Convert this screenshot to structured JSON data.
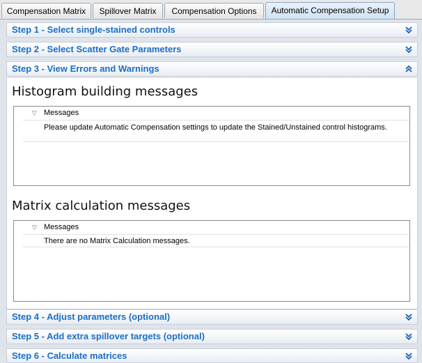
{
  "tabs": [
    {
      "label": "Compensation Matrix"
    },
    {
      "label": "Spillover Matrix"
    },
    {
      "label": "Compensation Options"
    },
    {
      "label": "Automatic Compensation Setup",
      "active": true
    }
  ],
  "steps": {
    "step1": "Step 1 - Select single-stained controls",
    "step2": "Step 2 - Select Scatter Gate Parameters",
    "step3": "Step 3 - View Errors and Warnings",
    "step4": "Step 4 - Adjust parameters (optional)",
    "step5": "Step 5 - Add extra spillover targets (optional)",
    "step6": "Step 6 - Calculate matrices"
  },
  "histogram": {
    "title": "Histogram building messages",
    "column_header": "Messages",
    "messages": [
      "Please update Automatic Compensation settings to update the Stained/Unstained control histograms."
    ]
  },
  "matrix": {
    "title": "Matrix calculation messages",
    "column_header": "Messages",
    "messages": [
      "There are no Matrix Calculation messages."
    ]
  },
  "colors": {
    "accent": "#1b6fc7",
    "panel_bg": "#dfe3ea"
  },
  "icons": {
    "expand": "double-chevron-down-icon",
    "collapse": "double-chevron-up-icon",
    "filter": "filter-icon"
  }
}
